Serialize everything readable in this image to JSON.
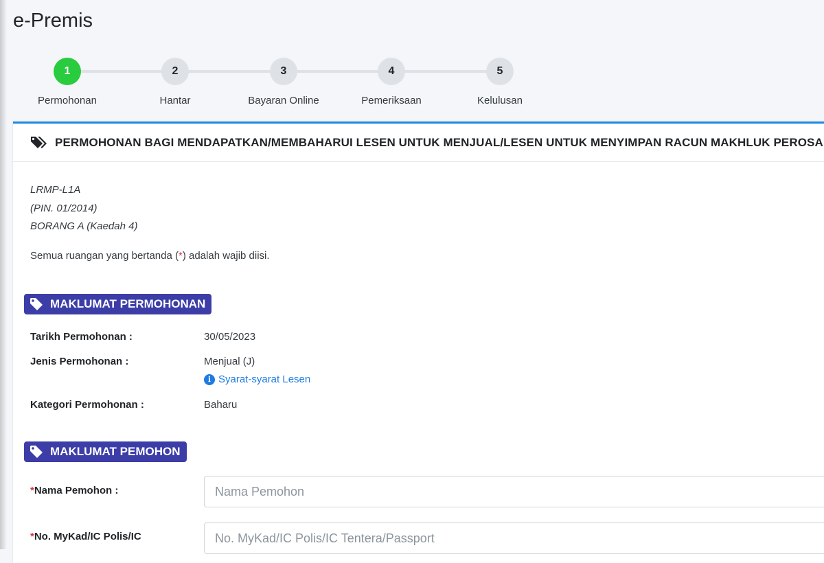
{
  "app": {
    "title": "e-Premis"
  },
  "stepper": {
    "steps": [
      {
        "number": "1",
        "label": "Permohonan",
        "active": true
      },
      {
        "number": "2",
        "label": "Hantar",
        "active": false
      },
      {
        "number": "3",
        "label": "Bayaran Online",
        "active": false
      },
      {
        "number": "4",
        "label": "Pemeriksaan",
        "active": false
      },
      {
        "number": "5",
        "label": "Kelulusan",
        "active": false
      }
    ]
  },
  "card": {
    "title": "PERMOHONAN BAGI MENDAPATKAN/MEMBAHARUI LESEN UNTUK MENJUAL/LESEN UNTUK MENYIMPAN RACUN MAKHLUK PEROSAK",
    "meta": [
      "LRMP-L1A",
      "(PIN. 01/2014)",
      "BORANG A (Kaedah 4)"
    ],
    "note_before": "Semua ruangan yang bertanda (",
    "note_star": "*",
    "note_after": ") adalah wajib diisi."
  },
  "section_application": {
    "title": "MAKLUMAT PERMOHONAN",
    "date_label": "Tarikh Permohonan :",
    "date_value": "30/05/2023",
    "type_label": "Jenis Permohonan :",
    "type_value": "Menjual (J)",
    "terms_link": "Syarat-syarat Lesen",
    "category_label": "Kategori Permohonan :",
    "category_value": "Baharu"
  },
  "section_applicant": {
    "title": "MAKLUMAT PEMOHON",
    "name_label": "Nama Pemohon :",
    "name_placeholder": "Nama Pemohon",
    "id_label": "No. MyKad/IC Polis/IC",
    "id_placeholder": "No. MyKad/IC Polis/IC Tentera/Passport"
  },
  "colors": {
    "accent": "#1e88e5",
    "step_active": "#28cc3e",
    "badge": "#3d3da8",
    "required": "#dc3545",
    "link": "#1e7be0"
  }
}
